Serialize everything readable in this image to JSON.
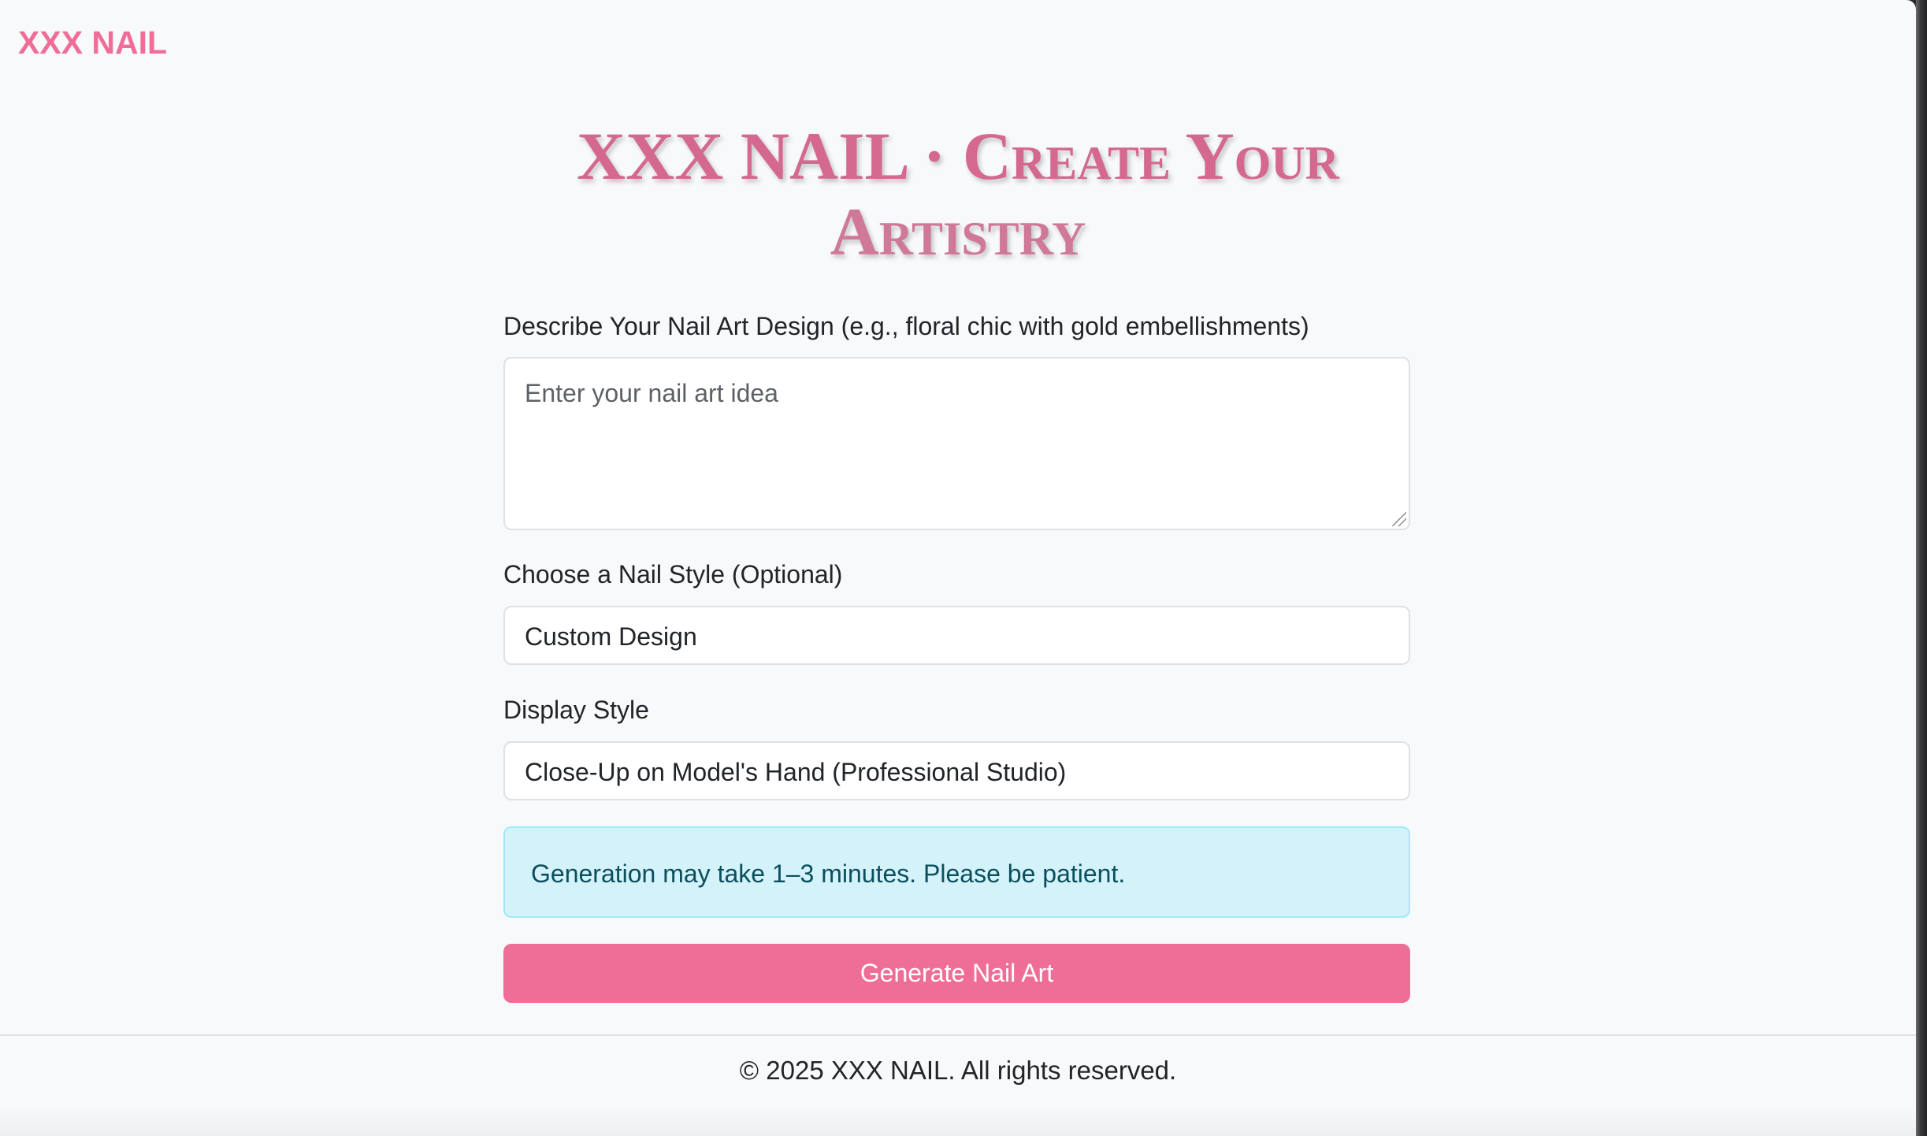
{
  "brand": {
    "name": "XXX NAIL",
    "color": "#ee6e97"
  },
  "hero": {
    "title_line1": "XXX NAIL · Create Your",
    "title_line2": "Artistry"
  },
  "form": {
    "design": {
      "label": "Describe Your Nail Art Design (e.g., floral chic with gold embellishments)",
      "placeholder": "Enter your nail art idea",
      "value": ""
    },
    "style": {
      "label": "Choose a Nail Style (Optional)",
      "selected": "Custom Design"
    },
    "display": {
      "label": "Display Style",
      "selected": "Close-Up on Model's Hand (Professional Studio)"
    },
    "notice": "Generation may take 1–3 minutes. Please be patient.",
    "submit_label": "Generate Nail Art"
  },
  "footer": {
    "copyright": "© 2025 XXX NAIL. All rights reserved."
  },
  "colors": {
    "accent": "#ee6e97",
    "info_bg": "#d3f2f9",
    "info_text": "#0b4f5e",
    "page_bg": "#f8f9fa"
  }
}
